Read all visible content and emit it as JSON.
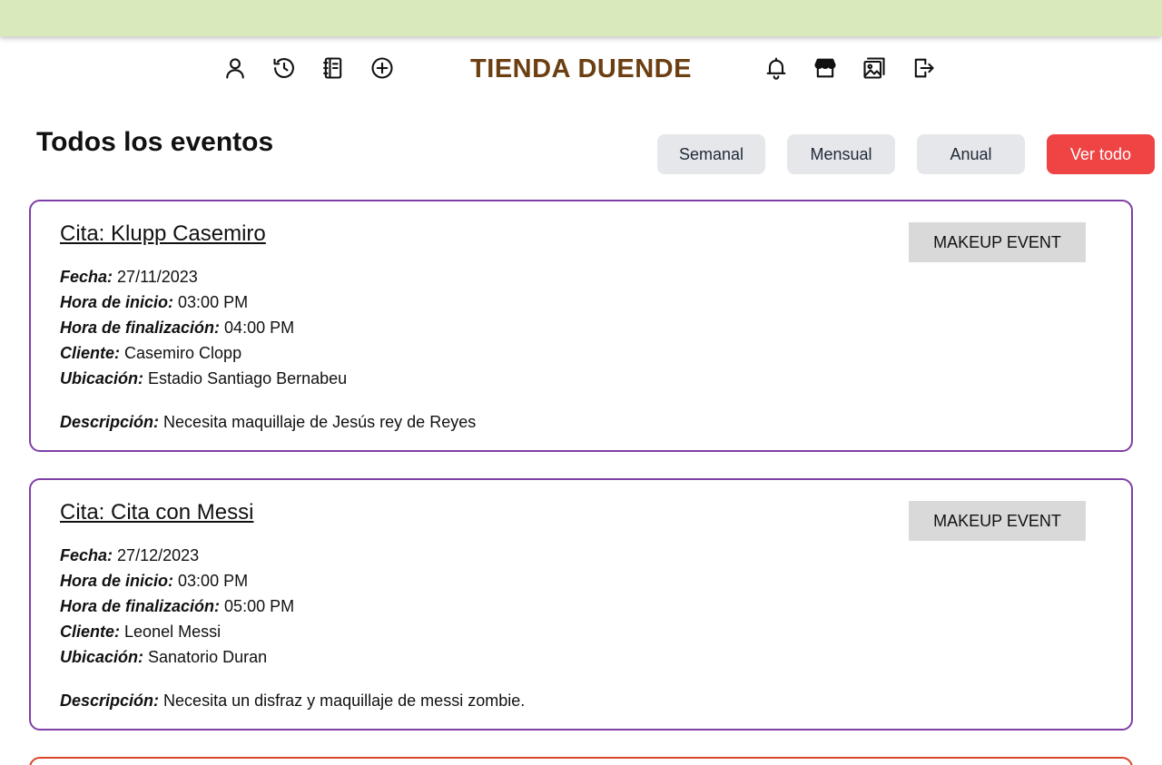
{
  "app": {
    "brand": "TIENDA DUENDE",
    "brand_color": "#6b3f12",
    "topbar_color": "#d9e9bb"
  },
  "nav": {
    "left_icons": [
      "user-icon",
      "history-icon",
      "notebook-icon",
      "add-circle-icon"
    ],
    "right_icons": [
      "bell-icon",
      "store-icon",
      "gallery-icon",
      "logout-icon"
    ]
  },
  "page": {
    "title": "Todos los eventos",
    "filters": [
      {
        "label": "Semanal",
        "active": false
      },
      {
        "label": "Mensual",
        "active": false
      },
      {
        "label": "Anual",
        "active": false
      },
      {
        "label": "Ver todo",
        "active": true
      }
    ]
  },
  "labels": {
    "fecha": "Fecha:",
    "hora_inicio": "Hora de inicio:",
    "hora_fin": "Hora de finalización:",
    "cliente": "Cliente:",
    "ubicacion": "Ubicación:",
    "descripcion": "Descripción:"
  },
  "events": [
    {
      "title": "Cita: Klupp Casemiro",
      "tag": "MAKEUP EVENT",
      "fecha": "27/11/2023",
      "hora_inicio": "03:00 PM",
      "hora_fin": "04:00 PM",
      "cliente": "Casemiro Clopp",
      "ubicacion": "Estadio Santiago Bernabeu",
      "descripcion": "Necesita maquillaje de Jesús rey de Reyes"
    },
    {
      "title": "Cita: Cita con Messi",
      "tag": "MAKEUP EVENT",
      "fecha": "27/12/2023",
      "hora_inicio": "03:00 PM",
      "hora_fin": "05:00 PM",
      "cliente": "Leonel Messi",
      "ubicacion": "Sanatorio Duran",
      "descripcion": "Necesita un disfraz y maquillaje de messi zombie."
    }
  ],
  "colors": {
    "card_border": "#7e3fa6",
    "filter_active": "#ef4444",
    "filter_inactive": "#e6e7ea",
    "tag_bg": "#d9d9d9",
    "next_card_border": "#d9442c"
  }
}
